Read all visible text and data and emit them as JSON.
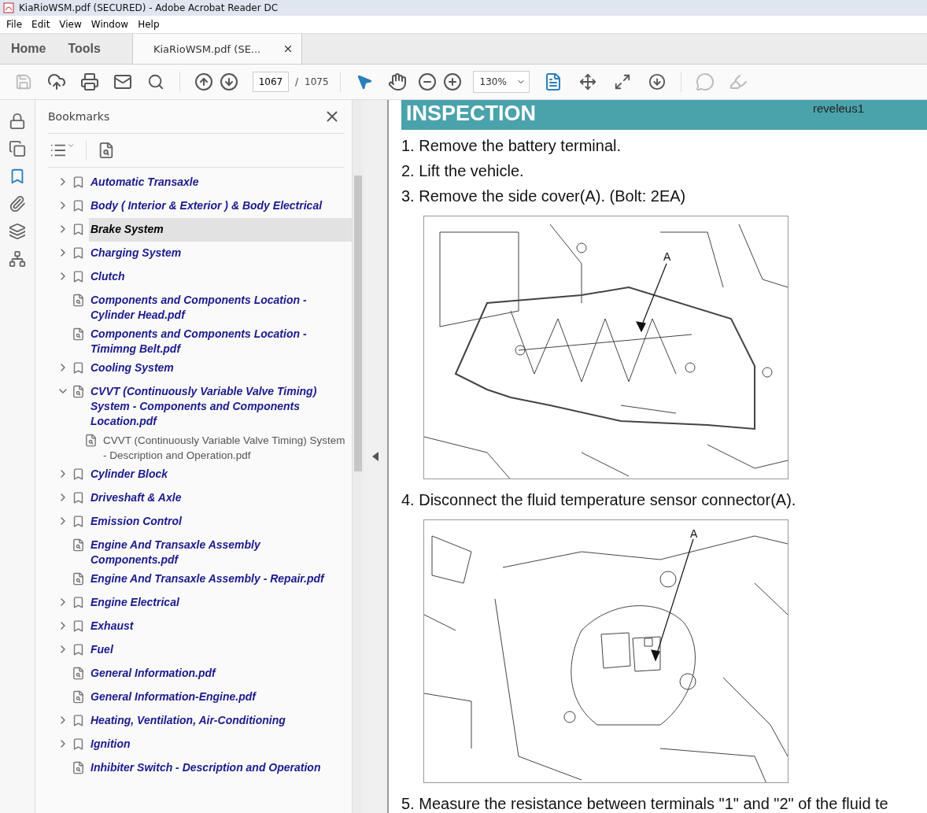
{
  "window": {
    "title": "KiaRioWSM.pdf (SECURED) - Adobe Acrobat Reader DC"
  },
  "menu": [
    "File",
    "Edit",
    "View",
    "Window",
    "Help"
  ],
  "tabs": [
    {
      "label": "Home",
      "kind": "nav",
      "selected": false
    },
    {
      "label": "Tools",
      "kind": "nav",
      "selected": false
    },
    {
      "label": "KiaRioWSM.pdf (SE...",
      "kind": "document",
      "selected": true
    }
  ],
  "toolbar": {
    "page": "1067",
    "separator": "/",
    "total": "1075",
    "zoom": "130%"
  },
  "rail": [
    {
      "kind": "lock",
      "selected": false
    },
    {
      "kind": "pages",
      "selected": false
    },
    {
      "kind": "bookmark",
      "selected": true
    },
    {
      "kind": "attachment",
      "selected": false
    },
    {
      "kind": "layers",
      "selected": false
    },
    {
      "kind": "structure",
      "selected": false
    }
  ],
  "bookmarks": {
    "title": "Bookmarks",
    "items": [
      {
        "label": "Automatic Transaxle",
        "kind": "folder",
        "expanded": false,
        "selected": false
      },
      {
        "label": "Body ( Interior & Exterior ) & Body Electrical",
        "kind": "folder",
        "expanded": false,
        "selected": false
      },
      {
        "label": "Brake System",
        "kind": "folder",
        "expanded": false,
        "selected": true
      },
      {
        "label": "Charging System",
        "kind": "folder",
        "expanded": false,
        "selected": false
      },
      {
        "label": "Clutch",
        "kind": "folder",
        "expanded": false,
        "selected": false
      },
      {
        "label": "Components and Components Location - Cylinder Head.pdf",
        "kind": "file",
        "selected": false
      },
      {
        "label": "Components and Components Location - Timimng Belt.pdf",
        "kind": "file",
        "selected": false
      },
      {
        "label": "Cooling System",
        "kind": "folder",
        "expanded": false,
        "selected": false
      },
      {
        "label": "CVVT (Continuously Variable Valve Timing) System - Components and Components Location.pdf",
        "kind": "file",
        "expanded": true,
        "selected": false,
        "children": [
          {
            "label": "CVVT (Continuously Variable Valve Timing) System - Description and Operation.pdf",
            "kind": "file",
            "selected": false
          }
        ]
      },
      {
        "label": "Cylinder Block",
        "kind": "folder",
        "expanded": false,
        "selected": false
      },
      {
        "label": "Driveshaft & Axle",
        "kind": "folder",
        "expanded": false,
        "selected": false
      },
      {
        "label": "Emission Control",
        "kind": "folder",
        "expanded": false,
        "selected": false
      },
      {
        "label": "Engine And Transaxle Assembly Components.pdf",
        "kind": "file",
        "selected": false
      },
      {
        "label": "Engine And Transaxle Assembly - Repair.pdf",
        "kind": "file",
        "selected": false
      },
      {
        "label": "Engine Electrical",
        "kind": "folder",
        "expanded": false,
        "selected": false
      },
      {
        "label": "Exhaust",
        "kind": "folder",
        "expanded": false,
        "selected": false
      },
      {
        "label": "Fuel",
        "kind": "folder",
        "expanded": false,
        "selected": false
      },
      {
        "label": "General Information.pdf",
        "kind": "file",
        "selected": false
      },
      {
        "label": "General Information-Engine.pdf",
        "kind": "file",
        "selected": false
      },
      {
        "label": "Heating, Ventilation, Air-Conditioning",
        "kind": "folder",
        "expanded": false,
        "selected": false
      },
      {
        "label": "Ignition",
        "kind": "folder",
        "expanded": false,
        "selected": false
      },
      {
        "label": "Inhibiter Switch - Description and Operation",
        "kind": "file",
        "selected": false
      }
    ]
  },
  "document": {
    "heading": "INSPECTION",
    "stamp": "reveleus1",
    "content": [
      {
        "kind": "step",
        "text": "1. Remove the battery terminal."
      },
      {
        "kind": "step",
        "text": "2. Lift the vehicle."
      },
      {
        "kind": "step",
        "text": "3. Remove the side cover(A). (Bolt: 2EA)"
      },
      {
        "kind": "figure",
        "callout": "A"
      },
      {
        "kind": "step",
        "text": "4. Disconnect the fluid temperature sensor connector(A)."
      },
      {
        "kind": "figure",
        "callout": "A"
      },
      {
        "kind": "step",
        "text": "5. Measure the resistance between terminals \"1\" and \"2\" of the fluid te"
      }
    ]
  }
}
